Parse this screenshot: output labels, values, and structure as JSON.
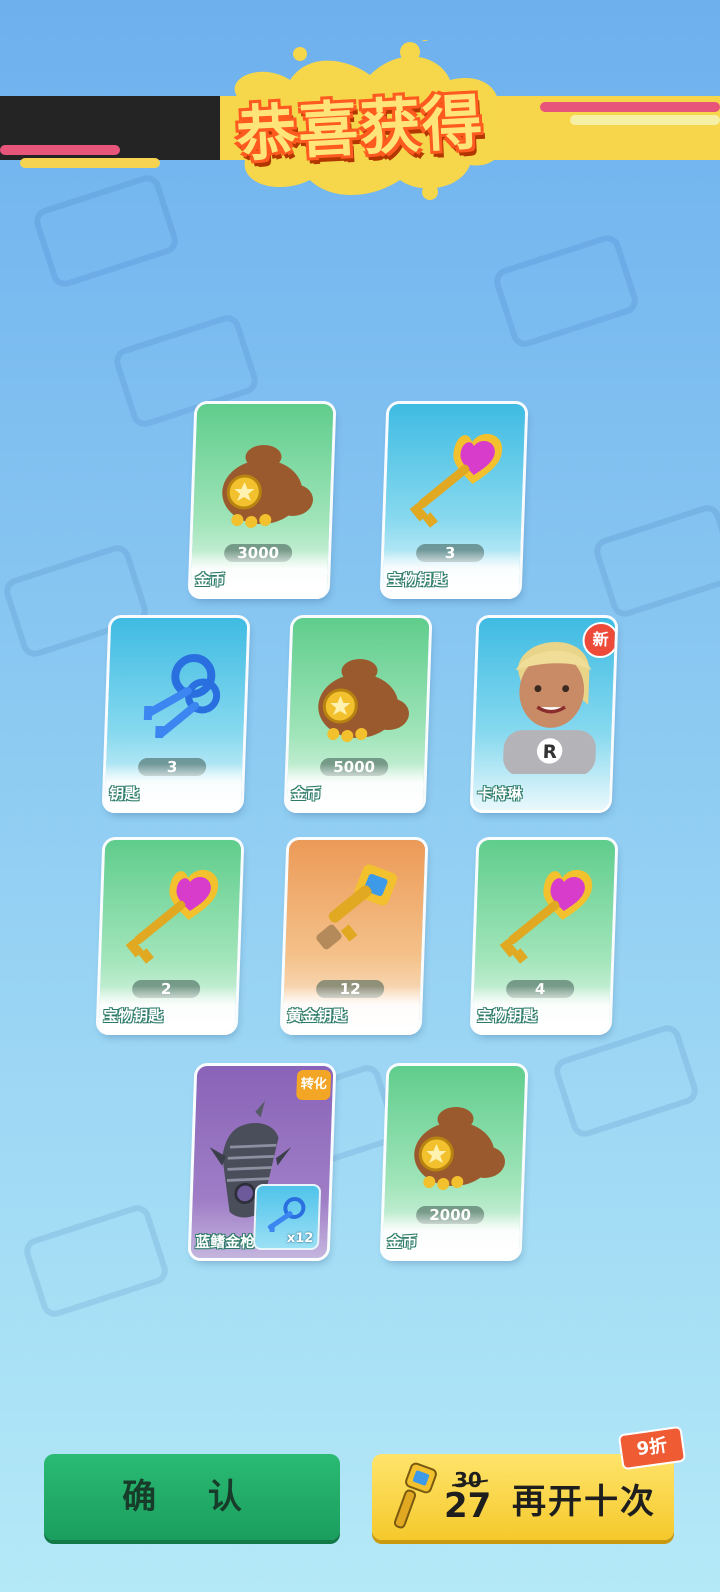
{
  "banner": {
    "title": "恭喜获得"
  },
  "rewards": [
    {
      "label": "金币",
      "count": "3000",
      "icon": "coin-bag-icon",
      "bg": "#5fcd8c"
    },
    {
      "label": "宝物钥匙",
      "count": "3",
      "icon": "heart-key-icon",
      "bg": "#3fbbe2"
    },
    {
      "label": "钥匙",
      "count": "3",
      "icon": "blue-keys-icon",
      "bg": "#3fbbe2"
    },
    {
      "label": "金币",
      "count": "5000",
      "icon": "coin-bag-icon",
      "bg": "#5fcd8c"
    },
    {
      "label": "卡特琳",
      "badge": "新",
      "icon": "character-portrait",
      "bg": "#3fbbe2"
    },
    {
      "label": "宝物钥匙",
      "count": "2",
      "icon": "heart-key-icon",
      "bg": "#5fcd8c"
    },
    {
      "label": "黄金钥匙",
      "count": "12",
      "icon": "gold-key-icon",
      "bg": "#ec9a57"
    },
    {
      "label": "宝物钥匙",
      "count": "4",
      "icon": "heart-key-icon",
      "bg": "#5fcd8c"
    },
    {
      "label": "蓝鳍金枪",
      "badge": "转化",
      "icon": "shark-board-icon",
      "mini_count": "x12",
      "bg": "#8a63b8"
    },
    {
      "label": "金币",
      "count": "2000",
      "icon": "coin-bag-icon",
      "bg": "#5fcd8c"
    }
  ],
  "buttons": {
    "confirm": "确 认",
    "again": "再开十次",
    "price_old": "30",
    "price_new": "27",
    "discount": "9折"
  }
}
